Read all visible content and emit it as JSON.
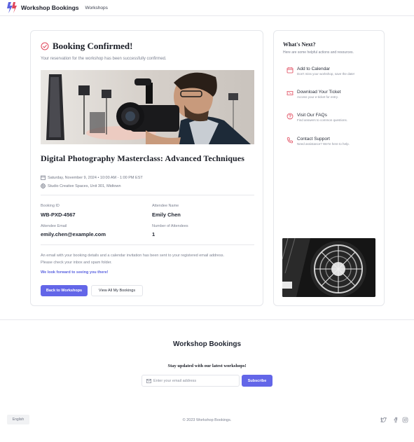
{
  "header": {
    "brand_name": "Workshop Bookings",
    "nav_workshops": "Workshops"
  },
  "confirmation": {
    "title": "Booking Confirmed!",
    "subtitle": "Your reservation for the workshop has been successfully confirmed."
  },
  "workshop": {
    "title": "Digital Photography Masterclass: Advanced Techniques",
    "datetime": "Saturday, November 9, 2024 • 10:00 AM - 1:00 PM EST",
    "location": "Studio Creative Spaces, Unit 301, Midtown"
  },
  "booking": {
    "id_label": "Booking ID",
    "id_value": "WB-PXD-4567",
    "attendee_label": "Attendee Name",
    "attendee_value": "Emily Chen",
    "email_label": "Attendee Email",
    "email_value": "emily.chen@example.com",
    "count_label": "Number of Attendees",
    "count_value": "1"
  },
  "notes": {
    "line1": "An email with your booking details and a calendar invitation has been sent to your registered email address.",
    "line2": "Please check your inbox and spam folder.",
    "accent": "We look forward to seeing you there!"
  },
  "buttons": {
    "back": "Back to Workshops",
    "view_all": "View All My Bookings"
  },
  "sidebar": {
    "title": "What's Next?",
    "subtitle": "Here are some helpful actions and resources.",
    "actions": [
      {
        "title": "Add to Calendar",
        "desc": "Don't miss your workshop, save the date!",
        "icon": "calendar-icon"
      },
      {
        "title": "Download Your Ticket",
        "desc": "Access your e-ticket for entry.",
        "icon": "ticket-icon"
      },
      {
        "title": "Visit Our FAQs",
        "desc": "Find answers to common questions.",
        "icon": "help-icon"
      },
      {
        "title": "Contact Support",
        "desc": "Need assistance? We're here to help.",
        "icon": "phone-icon"
      }
    ]
  },
  "footer": {
    "brand": "Workshop Bookings",
    "newsletter_title": "Stay updated with our latest workshops!",
    "email_placeholder": "Enter your email address",
    "subscribe": "Subscribe",
    "language": "English",
    "copyright": "© 2023 Workshop Bookings."
  },
  "colors": {
    "accent": "#6366e8",
    "success_icon": "#e0465a",
    "action_icon": "#e0465a"
  }
}
